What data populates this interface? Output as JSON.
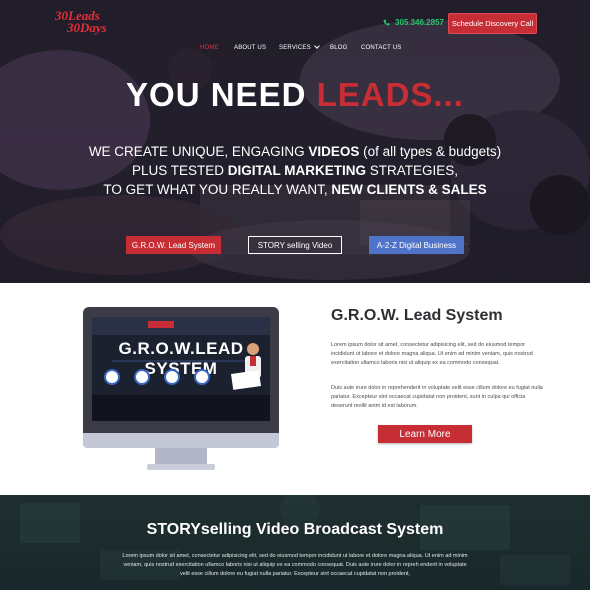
{
  "header": {
    "logo_line1": "30Leads",
    "logo_line2": "30Days",
    "phone": "305.346.2857",
    "cta_label": "Schedule Discovery Call"
  },
  "nav": {
    "items": [
      {
        "label": "HOME",
        "active": true
      },
      {
        "label": "ABOUT US",
        "active": false
      },
      {
        "label": "SERVICES",
        "active": false,
        "dropdown": true
      },
      {
        "label": "BLOG",
        "active": false
      },
      {
        "label": "CONTACT US",
        "active": false
      }
    ]
  },
  "hero": {
    "headline_main": "YOU NEED ",
    "headline_accent": "LEADS...",
    "sub_line1_a": "WE CREATE UNIQUE, ENGAGING ",
    "sub_line1_b": "VIDEOS",
    "sub_line1_c": " (of all types & budgets)",
    "sub_line2_a": "PLUS TESTED ",
    "sub_line2_b": "DIGITAL MARKETING",
    "sub_line2_c": " STRATEGIES,",
    "sub_line3_a": "TO GET WHAT YOU REALLY WANT, ",
    "sub_line3_b": "NEW CLIENTS & SALES",
    "buttons": [
      "G.R.O.W. Lead System",
      "STORY selling Video",
      "A-2-Z Digital Business"
    ]
  },
  "grow": {
    "title": "G.R.O.W. Lead System",
    "screen_title": "G.R.O.W.LEAD SYSTEM",
    "paragraph1": "Lorem ipsum dolor sit amet, consectetur adipisicing elit, sed do eiusmod tempor incididunt ut labore et dolore magna aliqua. Ut enim ad minim veniam, quis nostrud exercitation ullamco laboris nisi ut aliquip ex ea commodo consequat.",
    "paragraph2": "Duis aute irure dolor in reprehenderit in voluptate velit esse cillum dolore eu fugiat nulla pariatur. Excepteur sint occaecat cupidatat non proident, sunt in culpa qui officia deserunt mollit anim id est laborum.",
    "button": "Learn More"
  },
  "story": {
    "title": "STORYselling Video Broadcast System",
    "paragraph": "Lorem ipsum dolor sit amet, consectetur adipisicing elit, sed do eiusmod tempor incididunt ut labore et dolore magna aliqua. Ut enim ad minim veniam, quis nostrud exercitation ullamco laboris nisi ut aliquip ex ea commodo consequat. Duis aute irure dolor in repreh enderit in voluptate velit esse cillum dolore eu fugiat nulla pariatur. Excepteur sint occaecat cupidatat non proident,"
  },
  "icons": {
    "phone": "phone-icon",
    "chevron": "chevron-down-icon"
  },
  "colors": {
    "brand_red": "#c72d35",
    "accent_green": "#27c46a",
    "accent_blue": "#4f73c9"
  }
}
